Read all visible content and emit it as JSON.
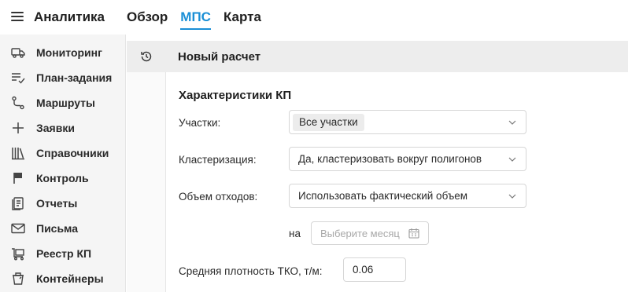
{
  "app": {
    "title": "Аналитика"
  },
  "nav_tabs": [
    {
      "label": "Обзор"
    },
    {
      "label": "МПС"
    },
    {
      "label": "Карта"
    }
  ],
  "sidebar": {
    "items": [
      {
        "label": "Мониторинг",
        "icon": "truck-icon"
      },
      {
        "label": "План-задания",
        "icon": "list-check-icon"
      },
      {
        "label": "Маршруты",
        "icon": "route-icon"
      },
      {
        "label": "Заявки",
        "icon": "plus-icon"
      },
      {
        "label": "Справочники",
        "icon": "library-icon"
      },
      {
        "label": "Контроль",
        "icon": "flag-icon"
      },
      {
        "label": "Отчеты",
        "icon": "report-icon"
      },
      {
        "label": "Письма",
        "icon": "mail-icon"
      },
      {
        "label": "Реестр КП",
        "icon": "cart-icon"
      },
      {
        "label": "Контейнеры",
        "icon": "container-icon"
      }
    ]
  },
  "header": {
    "title": "Новый расчет",
    "icon": "history-icon"
  },
  "form": {
    "section_title": "Характеристики КП",
    "areas": {
      "label": "Участки:",
      "value": "Все участки"
    },
    "clustering": {
      "label": "Кластеризация:",
      "value": "Да, кластеризовать вокруг полигонов"
    },
    "volume": {
      "label": "Объем отходов:",
      "value": "Использовать фактический объем"
    },
    "month": {
      "prefix": "на",
      "placeholder": "Выберите месяц"
    },
    "density": {
      "label": "Средняя плотность ТКО, т/м:",
      "value": "0.06"
    }
  },
  "colors": {
    "accent": "#1a8fd6",
    "sidebar_bg": "#f5f5f5",
    "header_bg": "#ededed"
  }
}
